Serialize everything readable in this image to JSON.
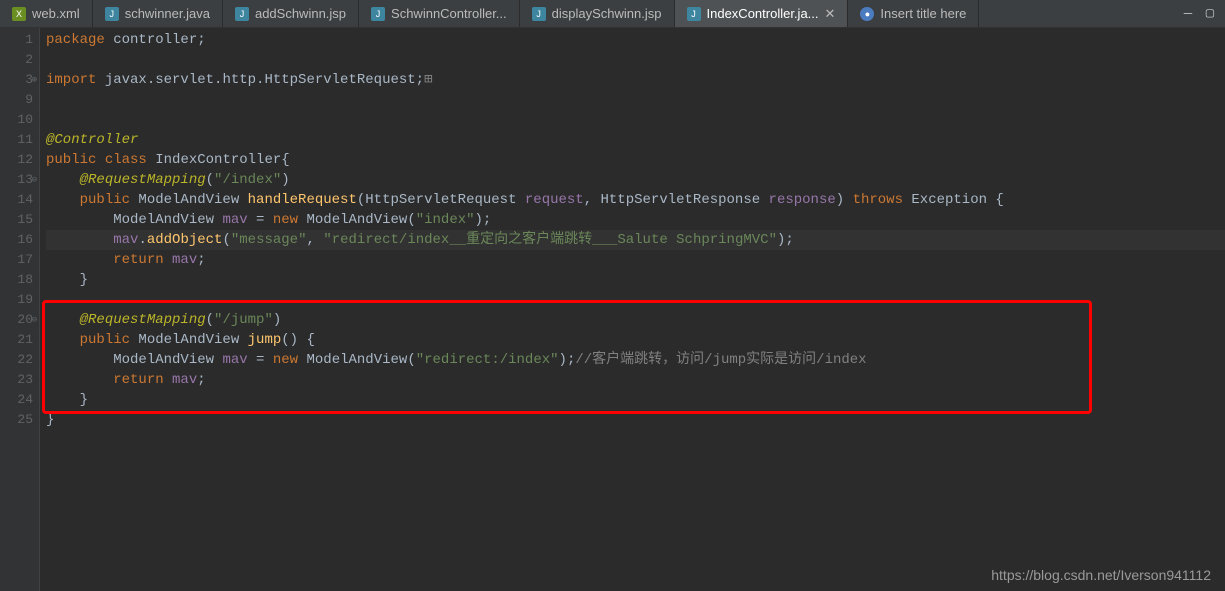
{
  "tabs": [
    {
      "label": "web.xml",
      "icon": "X"
    },
    {
      "label": "schwinner.java",
      "icon": "J"
    },
    {
      "label": "addSchwinn.jsp",
      "icon": "J"
    },
    {
      "label": "SchwinnController...",
      "icon": "J"
    },
    {
      "label": "displaySchwinn.jsp",
      "icon": "J"
    },
    {
      "label": "IndexController.ja...",
      "icon": "J",
      "active": true
    },
    {
      "label": "Insert title here",
      "icon": "●"
    }
  ],
  "lines": [
    "1",
    "2",
    "3",
    "9",
    "10",
    "11",
    "12",
    "13",
    "14",
    "15",
    "16",
    "17",
    "18",
    "19",
    "20",
    "21",
    "22",
    "23",
    "24",
    "25"
  ],
  "code": {
    "l1": {
      "kw_package": "package",
      "pkg": " controller;"
    },
    "l3": {
      "kw_import": "import",
      "imp": " javax.servlet.http.HttpServletRequest;"
    },
    "l11": {
      "ann": "@Controller"
    },
    "l12": {
      "kw_public": "public ",
      "kw_class": "class ",
      "cls": "IndexController",
      "brace": "{"
    },
    "l13": {
      "indent": "    ",
      "ann": "@RequestMapping",
      "paren": "(",
      "str": "\"/index\"",
      "paren2": ")"
    },
    "l14": {
      "indent": "    ",
      "kw_public": "public ",
      "type": "ModelAndView ",
      "method": "handleRequest",
      "sig1": "(HttpServletRequest ",
      "p1": "request",
      "sig2": ", HttpServletResponse ",
      "p2": "response",
      "sig3": ") ",
      "kw_throws": "throws ",
      "ex": "Exception ",
      "brace": "{"
    },
    "l15": {
      "indent": "        ",
      "type": "ModelAndView ",
      "var": "mav",
      "eq": " = ",
      "kw_new": "new ",
      "ctor": "ModelAndView",
      "paren": "(",
      "str": "\"index\"",
      "paren2": ");"
    },
    "l16": {
      "indent": "        ",
      "var": "mav",
      "dot": ".",
      "method": "addObject",
      "paren": "(",
      "str1": "\"message\"",
      "comma": ", ",
      "str2": "\"redirect/index__重定向之客户端跳转___Salute SchpringMVC\"",
      "paren2": ");"
    },
    "l17": {
      "indent": "        ",
      "kw_return": "return ",
      "var": "mav",
      "semi": ";"
    },
    "l18": {
      "indent": "    ",
      "brace": "}"
    },
    "l20": {
      "indent": "    ",
      "ann": "@RequestMapping",
      "paren": "(",
      "str": "\"/jump\"",
      "paren2": ")"
    },
    "l21": {
      "indent": "    ",
      "kw_public": "public ",
      "type": "ModelAndView ",
      "method": "jump",
      "sig": "() {"
    },
    "l22": {
      "indent": "        ",
      "type": "ModelAndView ",
      "var": "mav",
      "eq": " = ",
      "kw_new": "new ",
      "ctor": "ModelAndView",
      "paren": "(",
      "str": "\"redirect:/index\"",
      "paren2": ");",
      "comment": "//客户端跳转，访问/jump实际是访问/index"
    },
    "l23": {
      "indent": "        ",
      "kw_return": "return ",
      "var": "mav",
      "semi": ";"
    },
    "l24": {
      "indent": "    ",
      "brace": "}"
    },
    "l25": {
      "brace": "}"
    }
  },
  "watermark": "https://blog.csdn.net/Iverson941112"
}
